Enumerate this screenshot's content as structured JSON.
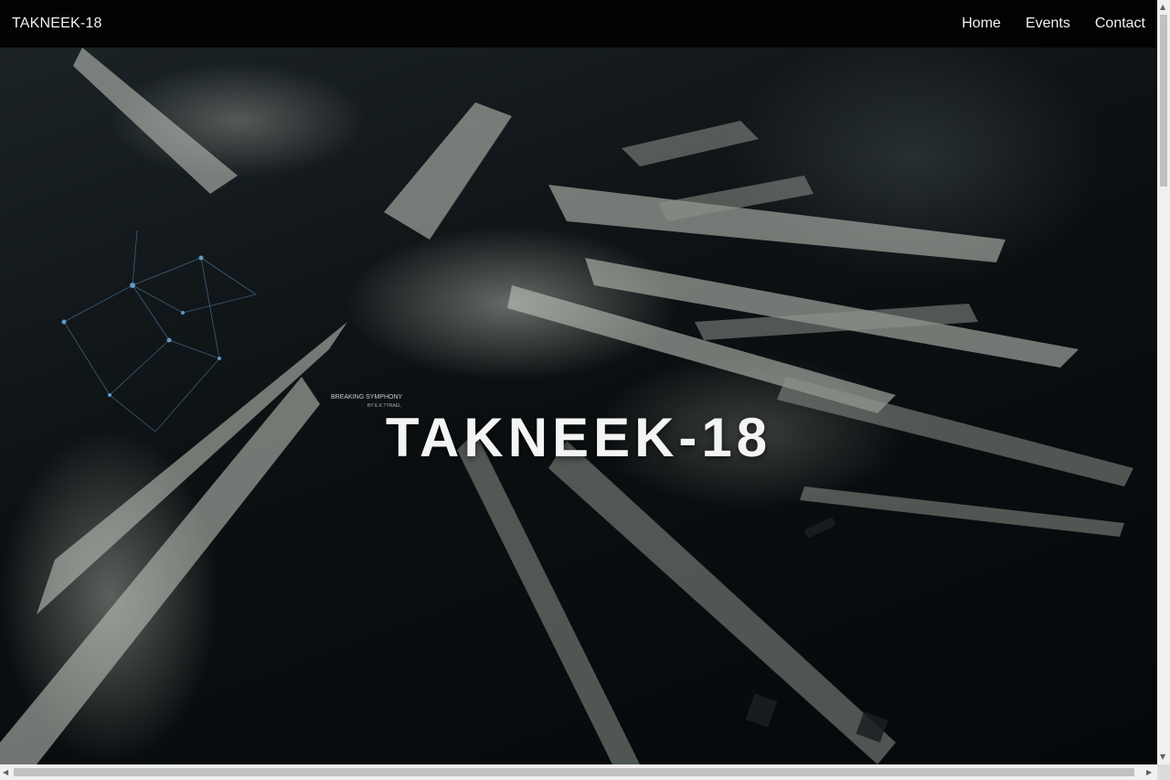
{
  "navbar": {
    "brand": "TAKNEEK-18",
    "links": [
      "Home",
      "Events",
      "Contact"
    ]
  },
  "hero": {
    "title": "TAKNEEK-18",
    "art_caption_line1": "BREAKING SYMPHONY",
    "art_caption_line2": "BY E.K.TYRAEL"
  },
  "scrollbars": {
    "up_arrow": "▲",
    "down_arrow": "▼",
    "left_arrow": "◀",
    "right_arrow": "▶"
  },
  "colors": {
    "navbar_bg": "#030303",
    "text": "#f2f2f2",
    "hero_dark": "#05080a"
  }
}
